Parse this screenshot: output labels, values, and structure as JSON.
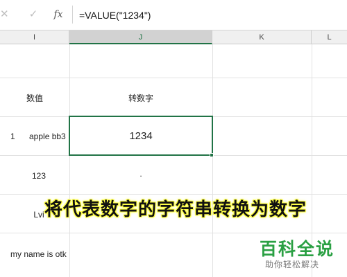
{
  "formula_bar": {
    "cancel_symbol": "✕",
    "confirm_symbol": "✓",
    "function_symbol": "fx",
    "formula": "=VALUE(\"1234\")"
  },
  "columns": [
    "I",
    "J",
    "K",
    "L"
  ],
  "rows": {
    "header": {
      "i": "数值",
      "j": "转数字"
    },
    "row1": {
      "i_index": "1",
      "i_text": "apple bb3",
      "j": "1234"
    },
    "row2": {
      "i": "123",
      "j": "."
    },
    "row3": {
      "i": "Lvi"
    },
    "row4": {
      "i": "my name is otk"
    }
  },
  "overlay_text": "将代表数字的字符串转换为数字",
  "watermark": {
    "title": "百科全说",
    "subtitle": "助你轻松解决"
  },
  "colors": {
    "selection": "#217346",
    "watermark": "#2aa043",
    "highlight": "#ffff33"
  }
}
